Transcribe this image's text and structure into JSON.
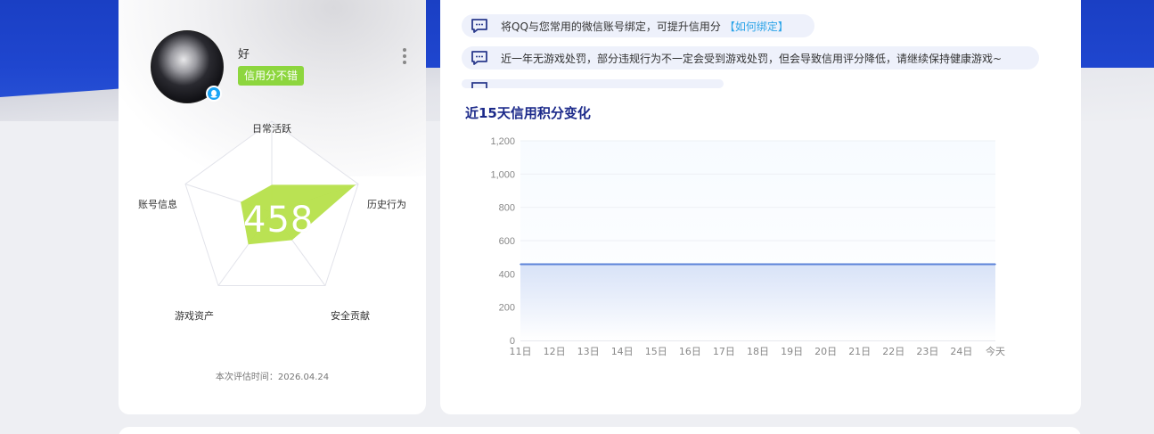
{
  "profile": {
    "username": "好",
    "credit_tag": "信用分不错",
    "score": "458",
    "eval_time_label": "本次评估时间：2026.04.24"
  },
  "radar": {
    "labels": {
      "top": "日常活跃",
      "right": "历史行为",
      "bottom_right": "安全贡献",
      "bottom_left": "游戏资产",
      "left": "账号信息"
    },
    "fill_color": "#b6e04a"
  },
  "notices": [
    {
      "text": "将QQ与您常用的微信账号绑定，可提升信用分",
      "link": "【如何绑定】"
    },
    {
      "text": "近一年无游戏处罚，部分违规行为不一定会受到游戏处罚，但会导致信用评分降低，请继续保持健康游戏~",
      "link": ""
    },
    {
      "text": "",
      "link": ""
    }
  ],
  "chart_title": "近15天信用积分变化",
  "chart_data": {
    "type": "area",
    "title": "近15天信用积分变化",
    "xlabel": "",
    "ylabel": "",
    "x": [
      "11日",
      "12日",
      "13日",
      "14日",
      "15日",
      "16日",
      "17日",
      "18日",
      "19日",
      "20日",
      "21日",
      "22日",
      "23日",
      "24日",
      "今天"
    ],
    "series": [
      {
        "values": [
          458,
          458,
          458,
          458,
          458,
          458,
          458,
          458,
          458,
          458,
          458,
          458,
          458,
          458,
          458
        ]
      }
    ],
    "ylim": [
      0,
      1200
    ],
    "yticks": [
      "0",
      "200",
      "400",
      "600",
      "800",
      "1,000",
      "1,200"
    ],
    "grid": true,
    "line_color": "#5b83d8"
  }
}
